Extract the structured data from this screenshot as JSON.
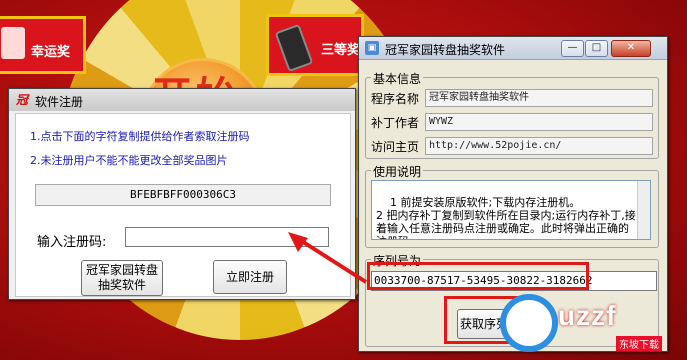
{
  "colors": {
    "accent_red": "#e01818",
    "window_bg": "#ece9d8",
    "link_blue": "#1a1ab0",
    "watermark_blue": "#2e8ee0"
  },
  "background": {
    "start_label": "开始",
    "prizes": [
      {
        "label": "幸运奖",
        "icon": "gift-icon"
      },
      {
        "label": "三等奖",
        "icon": "phone-icon"
      }
    ]
  },
  "register_dialog": {
    "title": "软件注册",
    "icon": "app-logo-icon",
    "instructions": [
      "1.点击下面的字符复制提供给作者索取注册码",
      "2.未注册用户不能不能更改全部奖品图片"
    ],
    "machine_code": "BFEBFBFF000306C3",
    "code_label": "输入注册码:",
    "code_value": "",
    "program_button": [
      "冠军家园转盘",
      "抽奖软件"
    ],
    "register_button": "立即注册"
  },
  "lottery_window": {
    "title": "冠军家园转盘抽奖软件",
    "controls": {
      "minimize": "—",
      "maximize": "□",
      "close": "✕"
    },
    "basic_info": {
      "group_title": "基本信息",
      "fields": [
        {
          "label": "程序名称",
          "value": "冠军家园转盘抽奖软件"
        },
        {
          "label": "补丁作者",
          "value": "WYWZ"
        },
        {
          "label": "访问主页",
          "value": "http://www.52pojie.cn/"
        }
      ]
    },
    "usage": {
      "group_title": "使用说明",
      "text": "1 前提安装原版软件;下载内存注册机。\n2 把内存补丁复制到软件所在目录内;运行内存补丁,接着输入任意注册码点注册或确定。此时将弹出正确的注册码。"
    },
    "serial": {
      "group_title": "序列号为",
      "value": "0033700-87517-53495-30822-3182662"
    },
    "get_serial_button": "获取序列号"
  },
  "watermark": {
    "text": "uzzf",
    "sub": "东坡下载",
    "icon": "uzzf-logo-icon"
  }
}
